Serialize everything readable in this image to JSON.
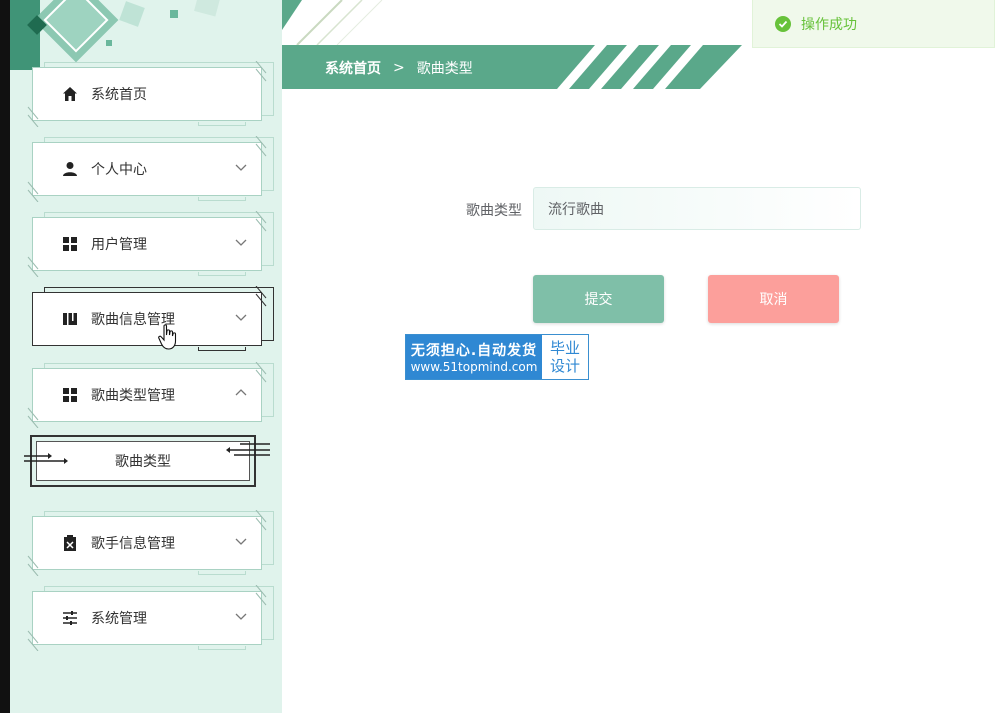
{
  "toast": {
    "message": "操作成功",
    "status_color": "#67c23a"
  },
  "breadcrumb": {
    "home": "系统首页",
    "separator": ">",
    "current": "歌曲类型"
  },
  "sidebar": {
    "items": [
      {
        "label": "系统首页",
        "icon": "home-icon"
      },
      {
        "label": "个人中心",
        "icon": "user-icon",
        "expandable": true
      },
      {
        "label": "用户管理",
        "icon": "grid-icon",
        "expandable": true
      },
      {
        "label": "歌曲信息管理",
        "icon": "book-icon",
        "expandable": true
      },
      {
        "label": "歌曲类型管理",
        "icon": "grid-icon",
        "expandable": true,
        "expanded": true
      },
      {
        "label": "歌手信息管理",
        "icon": "clipboard-icon",
        "expandable": true
      },
      {
        "label": "系统管理",
        "icon": "sliders-icon",
        "expandable": true
      }
    ],
    "submenu": {
      "label": "歌曲类型"
    }
  },
  "form": {
    "field_label": "歌曲类型",
    "field_value": "流行歌曲",
    "submit_label": "提交",
    "cancel_label": "取消"
  },
  "watermark": {
    "line1": "无须担心.自动发货",
    "line2": "www.51topmind.com",
    "right1": "毕业",
    "right2": "设计"
  },
  "colors": {
    "accent": "#5aa88a",
    "sidebar_bg": "#e0f3ec",
    "submit": "#7fbfa8",
    "cancel": "#fc9f9b"
  }
}
